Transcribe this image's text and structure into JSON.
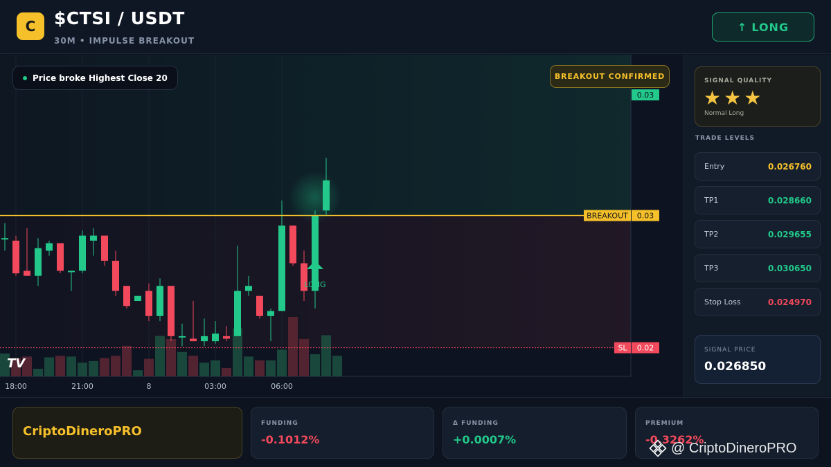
{
  "header": {
    "logo_letter": "C",
    "pair": "$CTSI / USDT",
    "subtitle": "30M • IMPULSE BREAKOUT",
    "action": {
      "arrow": "↑",
      "label": "LONG",
      "color": "#22c98a"
    }
  },
  "chart": {
    "condition_text": "Price broke Highest Close 20",
    "badge": "BREAKOUT CONFIRMED",
    "watermark_logo": "TV",
    "signal_marker_label": "LONG",
    "price_tags": [
      {
        "label": "",
        "value": "0.03",
        "price": 0.03,
        "kind": "current"
      },
      {
        "label": "BREAKOUT",
        "value": "0.03",
        "price": 0.0276,
        "kind": "breakout"
      },
      {
        "label": "SL",
        "value": "0.02",
        "price": 0.02497,
        "kind": "stop"
      }
    ],
    "colors": {
      "up": "#22c98a",
      "down": "#f2495c",
      "breakout": "#f5c02a",
      "stop": "#f2495c"
    }
  },
  "chart_data": {
    "type": "candlestick",
    "x_ticks": [
      "18:00",
      "21:00",
      "8",
      "03:00",
      "06:00"
    ],
    "ylim": [
      0.0244,
      0.0308
    ],
    "breakout_level": 0.0276,
    "stop_level": 0.02497,
    "candles": [
      {
        "o": 0.02715,
        "h": 0.02745,
        "l": 0.0269,
        "c": 0.02715
      },
      {
        "o": 0.0271,
        "h": 0.0272,
        "l": 0.0264,
        "c": 0.02645
      },
      {
        "o": 0.0265,
        "h": 0.02735,
        "l": 0.0264,
        "c": 0.0264
      },
      {
        "o": 0.0264,
        "h": 0.02715,
        "l": 0.0262,
        "c": 0.02695
      },
      {
        "o": 0.0269,
        "h": 0.0271,
        "l": 0.0268,
        "c": 0.02705
      },
      {
        "o": 0.02705,
        "h": 0.02705,
        "l": 0.02645,
        "c": 0.0265
      },
      {
        "o": 0.0265,
        "h": 0.0265,
        "l": 0.0261,
        "c": 0.0265
      },
      {
        "o": 0.0265,
        "h": 0.0273,
        "l": 0.02645,
        "c": 0.0272
      },
      {
        "o": 0.0271,
        "h": 0.02735,
        "l": 0.0268,
        "c": 0.0272
      },
      {
        "o": 0.0272,
        "h": 0.0272,
        "l": 0.0266,
        "c": 0.0267
      },
      {
        "o": 0.0267,
        "h": 0.0269,
        "l": 0.026,
        "c": 0.0261
      },
      {
        "o": 0.0262,
        "h": 0.0262,
        "l": 0.02575,
        "c": 0.0258
      },
      {
        "o": 0.0259,
        "h": 0.026,
        "l": 0.0259,
        "c": 0.026
      },
      {
        "o": 0.0261,
        "h": 0.02625,
        "l": 0.0255,
        "c": 0.0256
      },
      {
        "o": 0.0256,
        "h": 0.02635,
        "l": 0.0255,
        "c": 0.0262
      },
      {
        "o": 0.0262,
        "h": 0.0262,
        "l": 0.0251,
        "c": 0.0252
      },
      {
        "o": 0.0252,
        "h": 0.02545,
        "l": 0.025,
        "c": 0.0252
      },
      {
        "o": 0.02515,
        "h": 0.0259,
        "l": 0.0251,
        "c": 0.0251
      },
      {
        "o": 0.0251,
        "h": 0.02555,
        "l": 0.025,
        "c": 0.0252
      },
      {
        "o": 0.0251,
        "h": 0.0255,
        "l": 0.02505,
        "c": 0.02525
      },
      {
        "o": 0.0252,
        "h": 0.0254,
        "l": 0.0251,
        "c": 0.02515
      },
      {
        "o": 0.0252,
        "h": 0.027,
        "l": 0.0252,
        "c": 0.0261
      },
      {
        "o": 0.0261,
        "h": 0.0264,
        "l": 0.026,
        "c": 0.0262
      },
      {
        "o": 0.026,
        "h": 0.026,
        "l": 0.02555,
        "c": 0.0256
      },
      {
        "o": 0.0256,
        "h": 0.02575,
        "l": 0.0251,
        "c": 0.0257
      },
      {
        "o": 0.0257,
        "h": 0.0279,
        "l": 0.0257,
        "c": 0.0274
      },
      {
        "o": 0.0274,
        "h": 0.0274,
        "l": 0.0266,
        "c": 0.02665
      },
      {
        "o": 0.02665,
        "h": 0.0269,
        "l": 0.0259,
        "c": 0.0261
      },
      {
        "o": 0.0261,
        "h": 0.0277,
        "l": 0.02575,
        "c": 0.0276
      },
      {
        "o": 0.0277,
        "h": 0.02875,
        "l": 0.0276,
        "c": 0.0283
      }
    ],
    "volumes": [
      3,
      2.4,
      2.6,
      1,
      2.5,
      2.7,
      2.6,
      1.8,
      2,
      2.4,
      2.7,
      4,
      0.8,
      2.3,
      5.3,
      4.9,
      3.2,
      2.7,
      1.8,
      2.1,
      1.1,
      6.3,
      2.6,
      2.1,
      2.1,
      3.5,
      7.8,
      4.9,
      2.9,
      5.4,
      2.7
    ]
  },
  "quality": {
    "title": "SIGNAL QUALITY",
    "stars": "★★★",
    "rating": 3,
    "subtitle": "Normal Long"
  },
  "levels": {
    "title": "TRADE LEVELS",
    "items": [
      {
        "label": "Entry",
        "value": "0.026760",
        "color": "#f5c02a"
      },
      {
        "label": "TP1",
        "value": "0.028660",
        "color": "#22c98a"
      },
      {
        "label": "TP2",
        "value": "0.029655",
        "color": "#22c98a"
      },
      {
        "label": "TP3",
        "value": "0.030650",
        "color": "#22c98a"
      },
      {
        "label": "Stop Loss",
        "value": "0.024970",
        "color": "#f2495c"
      }
    ]
  },
  "signal": {
    "title": "SIGNAL PRICE",
    "value": "0.026850"
  },
  "footer": {
    "brand": "CriptoDineroPRO",
    "stats": [
      {
        "title": "FUNDING",
        "value": "-0.1012%",
        "color": "#f2495c"
      },
      {
        "title": "Δ FUNDING",
        "value": "+0.0007%",
        "color": "#22c98a"
      },
      {
        "title": "PREMIUM",
        "value": "-0.3262%",
        "color": "#f2495c"
      }
    ],
    "watermark": "@ CriptoDineroPRO"
  }
}
